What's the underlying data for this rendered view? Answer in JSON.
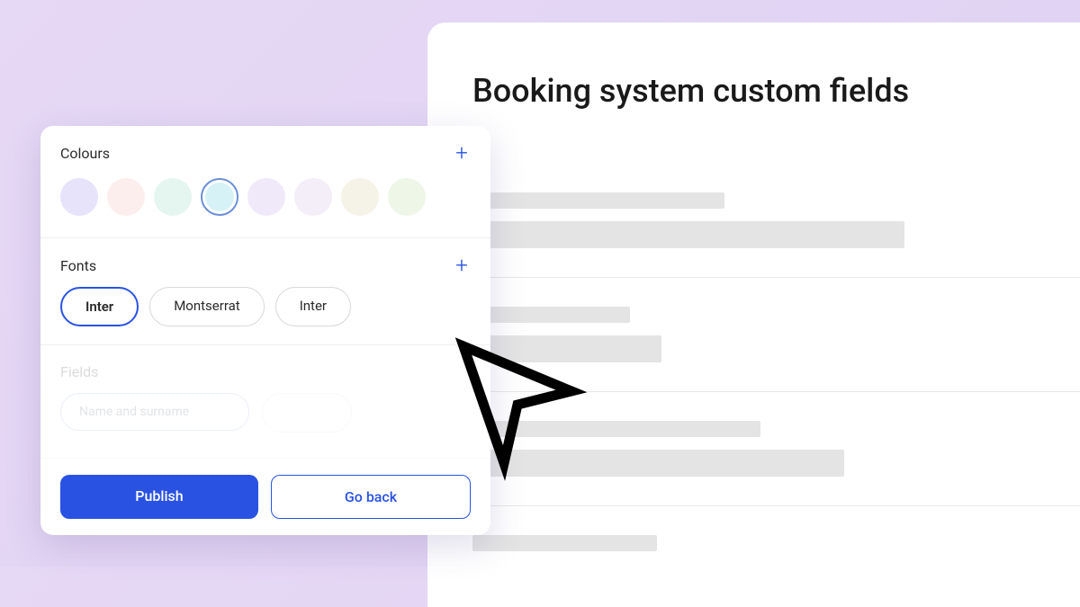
{
  "main": {
    "title": "Booking system custom fields"
  },
  "sidebar": {
    "colours": {
      "label": "Colours",
      "swatches": [
        {
          "color": "#e6e3fb",
          "selected": false
        },
        {
          "color": "#fdeeee",
          "selected": false
        },
        {
          "color": "#e5f5f0",
          "selected": false
        },
        {
          "color": "#d6f2f7",
          "selected": true
        },
        {
          "color": "#f0e9fa",
          "selected": false
        },
        {
          "color": "#f3eef7",
          "selected": false
        },
        {
          "color": "#f5f2e8",
          "selected": false
        },
        {
          "color": "#eef6e7",
          "selected": false
        }
      ]
    },
    "fonts": {
      "label": "Fonts",
      "options": [
        {
          "name": "Inter",
          "selected": true
        },
        {
          "name": "Montserrat",
          "selected": false
        },
        {
          "name": "Inter",
          "selected": false
        }
      ]
    },
    "fields": {
      "label": "Fields",
      "placeholder": "Name and surname"
    },
    "actions": {
      "publish": "Publish",
      "back": "Go back"
    }
  }
}
